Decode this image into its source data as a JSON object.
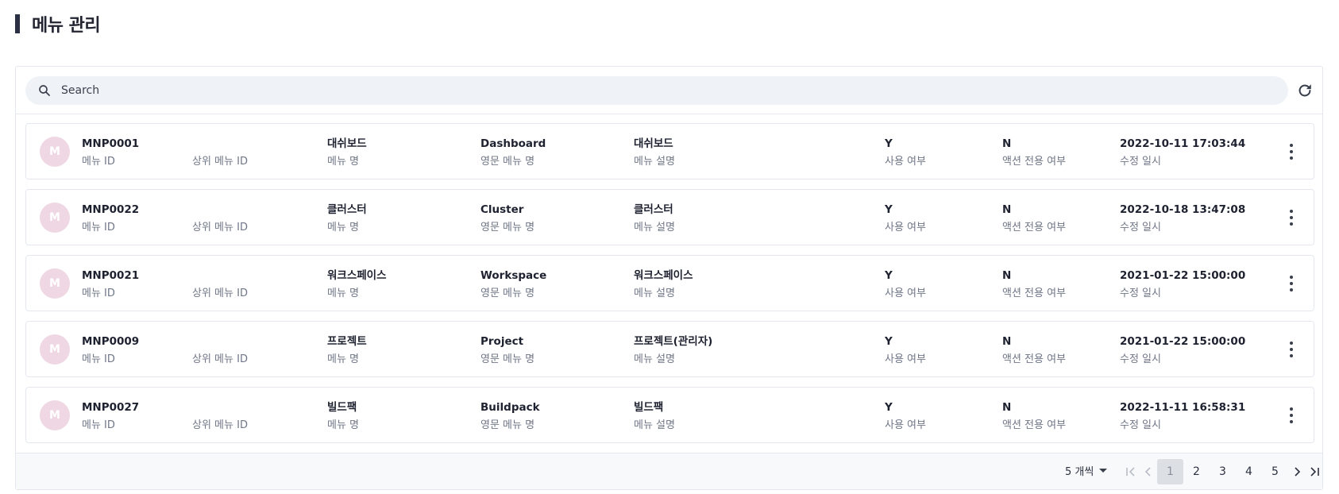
{
  "page": {
    "title": "메뉴 관리"
  },
  "search": {
    "placeholder": "Search"
  },
  "labels": {
    "menu_id": "메뉴 ID",
    "parent_id": "상위 메뉴 ID",
    "menu_name": "메뉴 명",
    "en_name": "영문 메뉴 명",
    "desc": "메뉴 설명",
    "use": "사용 여부",
    "action_only": "액션 전용 여부",
    "modified": "수정 일시"
  },
  "rows": [
    {
      "avatar": "M",
      "id": "MNP0001",
      "parent": "",
      "name": "대쉬보드",
      "en_name": "Dashboard",
      "desc": "대쉬보드",
      "use": "Y",
      "action_only": "N",
      "modified": "2022-10-11 17:03:44"
    },
    {
      "avatar": "M",
      "id": "MNP0022",
      "parent": "",
      "name": "클러스터",
      "en_name": "Cluster",
      "desc": "클러스터",
      "use": "Y",
      "action_only": "N",
      "modified": "2022-10-18 13:47:08"
    },
    {
      "avatar": "M",
      "id": "MNP0021",
      "parent": "",
      "name": "워크스페이스",
      "en_name": "Workspace",
      "desc": "워크스페이스",
      "use": "Y",
      "action_only": "N",
      "modified": "2021-01-22 15:00:00"
    },
    {
      "avatar": "M",
      "id": "MNP0009",
      "parent": "",
      "name": "프로젝트",
      "en_name": "Project",
      "desc": "프로젝트(관리자)",
      "use": "Y",
      "action_only": "N",
      "modified": "2021-01-22 15:00:00"
    },
    {
      "avatar": "M",
      "id": "MNP0027",
      "parent": "",
      "name": "빌드팩",
      "en_name": "Buildpack",
      "desc": "빌드팩",
      "use": "Y",
      "action_only": "N",
      "modified": "2022-11-11 16:58:31"
    }
  ],
  "pagination": {
    "page_size_label": "5 개씩",
    "pages": [
      "1",
      "2",
      "3",
      "4",
      "5"
    ],
    "current": "1"
  },
  "icons": {
    "search": "search-icon",
    "refresh": "refresh-icon",
    "more": "more-vertical-icon",
    "first": "first-page-icon",
    "prev": "prev-page-icon",
    "next": "next-page-icon",
    "last": "last-page-icon"
  },
  "colors": {
    "accent_bar": "#2b3044",
    "avatar_bg": "#efd8e3",
    "search_bg": "#eff3f7",
    "active_page_bg": "#dcdfe4"
  }
}
